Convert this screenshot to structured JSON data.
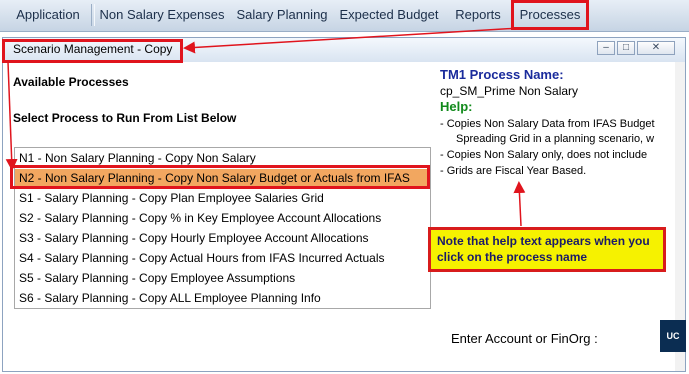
{
  "menubar": {
    "items": [
      {
        "label": "Application"
      },
      {
        "label": "Non Salary Expenses"
      },
      {
        "label": "Salary Planning"
      },
      {
        "label": "Expected Budget"
      },
      {
        "label": "Reports"
      },
      {
        "label": "Processes"
      }
    ]
  },
  "window": {
    "title": "Scenario Management - Copy",
    "available_label": "Available Processes",
    "select_label": "Select Process to Run From List Below"
  },
  "processes": {
    "items": [
      {
        "label": "N1 - Non Salary Planning - Copy Non Salary"
      },
      {
        "label": "N2 - Non Salary Planning - Copy Non Salary Budget or Actuals from IFAS",
        "selected": true
      },
      {
        "label": "S1 - Salary Planning - Copy Plan Employee Salaries Grid"
      },
      {
        "label": "S2 - Salary Planning - Copy % in Key Employee Account Allocations"
      },
      {
        "label": "S3 - Salary Planning - Copy Hourly Employee Account Allocations"
      },
      {
        "label": "S4 - Salary Planning - Copy Actual Hours from IFAS Incurred Actuals"
      },
      {
        "label": "S5 - Salary Planning - Copy Employee Assumptions"
      },
      {
        "label": "S6 - Salary Planning - Copy ALL Employee Planning Info"
      }
    ]
  },
  "help_pane": {
    "process_name_title": "TM1 Process Name:",
    "process_name": "cp_SM_Prime Non Salary",
    "help_label": "Help:",
    "lines": [
      "- Copies Non Salary Data from IFAS Budget",
      "Spreading Grid in a planning scenario, w",
      "- Copies Non Salary only, does not include",
      "- Grids are Fiscal Year Based."
    ]
  },
  "callout": {
    "text": "Note that help text appears when you click on the process name"
  },
  "footer": {
    "enter_label": "Enter Account or FinOrg :",
    "logo_text": "UC"
  },
  "colors": {
    "highlight_red": "#e0141d",
    "selected_row": "#f2a760",
    "callout_yellow": "#f6f200",
    "help_title_blue": "#1a2b9c",
    "help_label_green": "#118a1b"
  }
}
